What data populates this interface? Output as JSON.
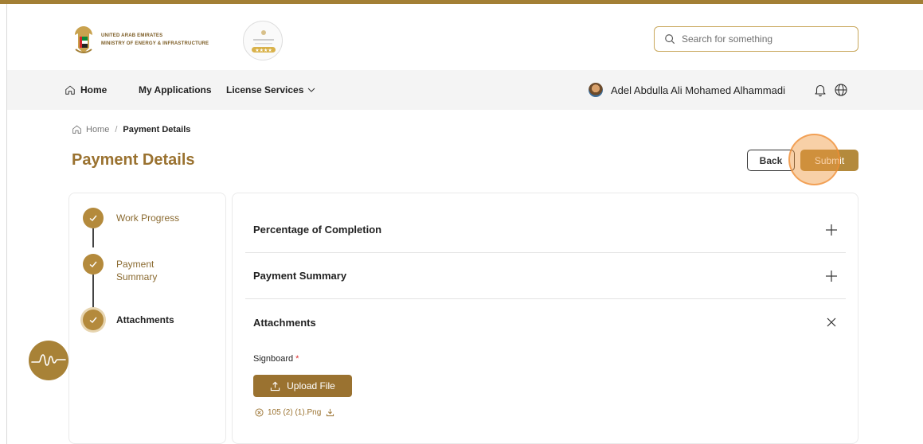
{
  "header": {
    "logo_line1": "UNITED ARAB EMIRATES",
    "logo_line2": "MINISTRY OF ENERGY & INFRASTRUCTURE",
    "search_placeholder": "Search for something"
  },
  "nav": {
    "home": "Home",
    "my_applications": "My Applications",
    "license_services": "License Services",
    "user_name": "Adel Abdulla Ali Mohamed Alhammadi"
  },
  "breadcrumb": {
    "home": "Home",
    "separator": "/",
    "current": "Payment Details"
  },
  "page": {
    "title": "Payment Details",
    "back_label": "Back",
    "submit_label": "Submit"
  },
  "steps": [
    {
      "label": "Work Progress",
      "active": false
    },
    {
      "label": "Payment Summary",
      "active": false
    },
    {
      "label": "Attachments",
      "active": true
    }
  ],
  "accordion": [
    {
      "title": "Percentage of Completion",
      "state": "collapsed",
      "icon": "plus-icon"
    },
    {
      "title": "Payment Summary",
      "state": "collapsed",
      "icon": "plus-icon"
    },
    {
      "title": "Attachments",
      "state": "expanded",
      "icon": "close-icon"
    }
  ],
  "attachments": {
    "field_label": "Signboard",
    "required_mark": "*",
    "upload_label": "Upload File",
    "file_name": "105 (2) (1).Png"
  },
  "colors": {
    "brand": "#9a7230",
    "accent": "#b48a3c"
  }
}
